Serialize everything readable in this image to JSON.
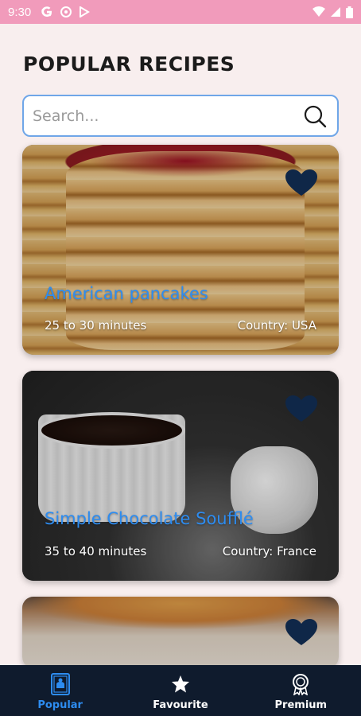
{
  "status_bar": {
    "time": "9:30",
    "left_icons": [
      "google-icon",
      "location-icon",
      "play-store-icon"
    ],
    "right_icons": [
      "wifi-icon",
      "cellular-icon",
      "battery-icon"
    ]
  },
  "page": {
    "title": "POPULAR RECIPES"
  },
  "search": {
    "placeholder": "Search...",
    "value": "",
    "icon": "search-icon"
  },
  "recipes": [
    {
      "name": "American pancakes",
      "time": "25 to 30 minutes",
      "country": "Country: USA",
      "favourite_icon": "heart-icon"
    },
    {
      "name": "Simple Chocolate Soufflé",
      "time": "35 to 40 minutes",
      "country": "Country: France",
      "favourite_icon": "heart-icon"
    },
    {
      "name": "",
      "time": "",
      "country": "",
      "favourite_icon": "heart-icon"
    }
  ],
  "bottom_nav": {
    "items": [
      {
        "label": "Popular",
        "icon": "recipe-book-icon",
        "active": true
      },
      {
        "label": "Favourite",
        "icon": "star-icon",
        "active": false
      },
      {
        "label": "Premium",
        "icon": "premium-badge-icon",
        "active": false
      }
    ]
  },
  "colors": {
    "status_bar": "#f19bbb",
    "background": "#f8eeee",
    "accent": "#2d8cf0",
    "search_border": "#6fa6e8",
    "heart": "#0f2748",
    "nav_background": "#0f1b2d"
  }
}
